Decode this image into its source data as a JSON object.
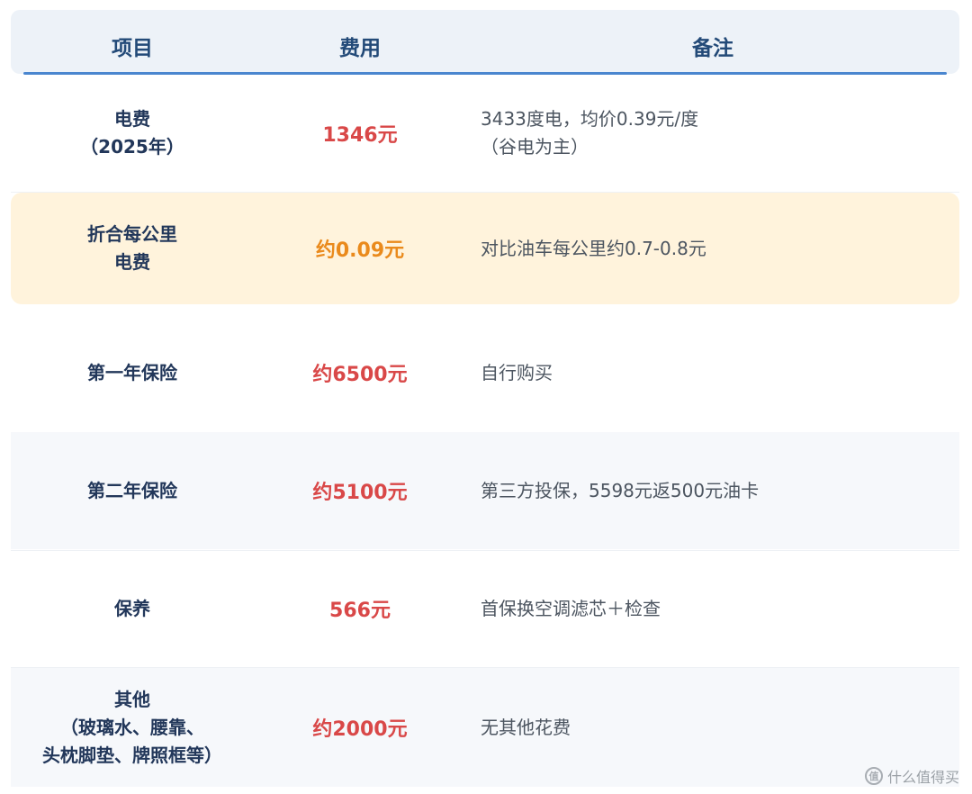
{
  "table": {
    "headers": {
      "item": "项目",
      "cost": "费用",
      "note": "备注"
    },
    "rows": [
      {
        "item_lines": [
          "电费",
          "（2025年）"
        ],
        "cost": "1346元",
        "note_lines": [
          "3433度电，均价0.39元/度",
          "（谷电为主）"
        ]
      },
      {
        "item_lines": [
          "折合每公里",
          "电费"
        ],
        "cost": "约0.09元",
        "note_lines": [
          "对比油车每公里约0.7-0.8元"
        ],
        "highlight": true
      },
      {
        "item_lines": [
          "第一年保险"
        ],
        "cost": "约6500元",
        "note_lines": [
          "自行购买"
        ]
      },
      {
        "item_lines": [
          "第二年保险"
        ],
        "cost": "约5100元",
        "note_lines": [
          "第三方投保，5598元返500元油卡"
        ]
      },
      {
        "item_lines": [
          "保养"
        ],
        "cost": "566元",
        "note_lines": [
          "首保换空调滤芯＋检查"
        ]
      },
      {
        "item_lines": [
          "其他",
          "（玻璃水、腰靠、",
          "头枕脚垫、牌照框等）"
        ],
        "cost": "约2000元",
        "note_lines": [
          "无其他花费"
        ]
      }
    ]
  },
  "watermark": {
    "icon": "zhi-logo-icon",
    "icon_glyph": "值",
    "text": "什么值得买"
  },
  "colors": {
    "header_bg": "#edf2f8",
    "header_text": "#234a78",
    "header_underline": "#4a86cf",
    "cost_red": "#d94848",
    "cost_orange": "#ea8a1c",
    "highlight_bg": "#fff3dc",
    "alt_row_bg": "#f6f8fb"
  }
}
